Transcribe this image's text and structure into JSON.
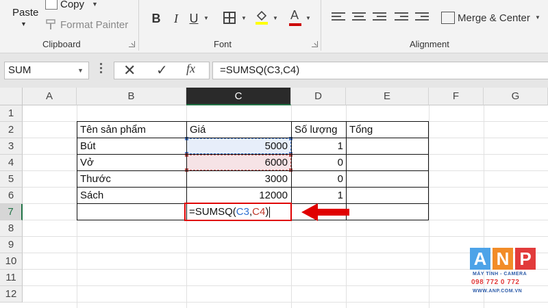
{
  "ribbon": {
    "clipboard": {
      "paste_label": "Paste",
      "copy_label": "Copy",
      "format_painter_label": "Format Painter",
      "group_label": "Clipboard"
    },
    "font": {
      "bold_label": "B",
      "italic_label": "I",
      "underline_label": "U",
      "font_color_label": "A",
      "group_label": "Font"
    },
    "alignment": {
      "merge_label": "Merge & Center",
      "group_label": "Alignment"
    }
  },
  "formula_bar": {
    "name_box": "SUM",
    "cancel_glyph": "✕",
    "enter_glyph": "✓",
    "fx_label": "fx",
    "formula": "=SUMSQ(C3,C4)"
  },
  "columns": [
    "A",
    "B",
    "C",
    "D",
    "E",
    "F",
    "G"
  ],
  "active_column": "C",
  "rows": [
    "1",
    "2",
    "3",
    "4",
    "5",
    "6",
    "7",
    "8",
    "9",
    "10",
    "11",
    "12"
  ],
  "active_row": "7",
  "table": {
    "headers": [
      "Tên sản phẩm",
      "Giá",
      "Số lượng",
      "Tổng"
    ],
    "items": [
      {
        "name": "Bút",
        "price": "5000",
        "qty": "1"
      },
      {
        "name": "Vở",
        "price": "6000",
        "qty": "0"
      },
      {
        "name": "Thước",
        "price": "3000",
        "qty": "0"
      },
      {
        "name": "Sách",
        "price": "12000",
        "qty": "1"
      }
    ]
  },
  "editing_cell": {
    "prefix": "=SUMSQ(",
    "ref1": "C3",
    "sep": ",",
    "ref2": "C4",
    "suffix": ")"
  },
  "colors": {
    "accent_green": "#217346",
    "ref_blue": "#4a7ccf",
    "ref_red": "#c0504d",
    "highlight_red": "#e00000"
  },
  "watermark": {
    "letters": [
      "A",
      "N",
      "P"
    ],
    "tagline": "MÁY TÍNH - CAMERA",
    "phone": "098 772 0 772",
    "website": "WWW.ANP.COM.VN"
  }
}
